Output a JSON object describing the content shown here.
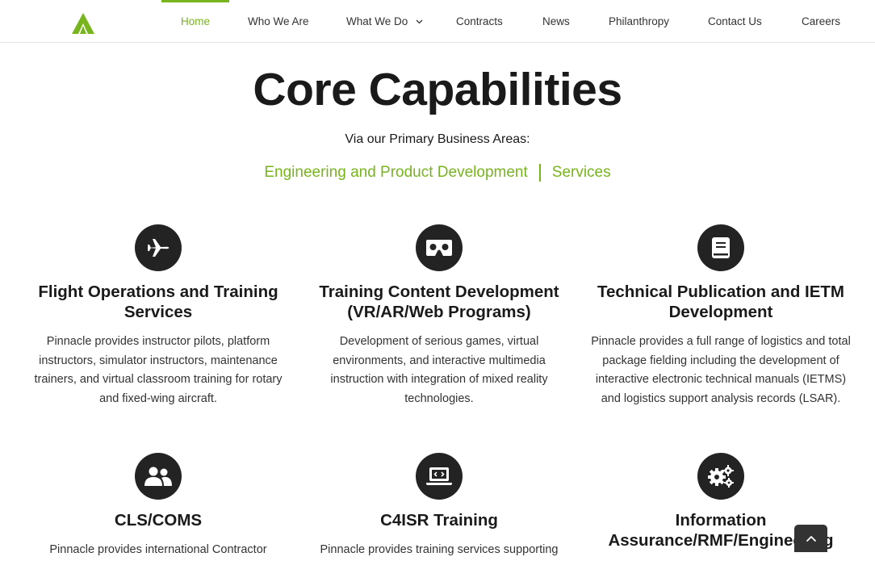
{
  "nav": {
    "logo_icon": "pinnacle-logo-triangle",
    "items": [
      {
        "label": "Home",
        "active": true
      },
      {
        "label": "Who We Are"
      },
      {
        "label": "What We Do"
      },
      {
        "label": "Contracts"
      },
      {
        "label": "News"
      },
      {
        "label": "Philanthropy"
      },
      {
        "label": "Contact Us"
      },
      {
        "label": "Careers"
      }
    ]
  },
  "hero": {
    "title": "Core Capabilities",
    "subtitle": "Via our Primary Business Areas:",
    "area_1": "Engineering and Product Development",
    "area_2": "Services"
  },
  "cards": [
    {
      "icon": "airplane-icon",
      "title": "Flight Operations and Training Services",
      "text": "Pinnacle provides instructor pilots, platform instructors, simulator instructors, maintenance trainers, and virtual classroom training for rotary and fixed-wing aircraft."
    },
    {
      "icon": "vr-headset-icon",
      "title": "Training Content Development (VR/AR/Web Programs)",
      "text": "Development of serious games, virtual environments, and interactive multimedia instruction with integration of mixed reality technologies."
    },
    {
      "icon": "book-icon",
      "title": "Technical Publication and IETM Development",
      "text": "Pinnacle provides a full range of logistics and total package fielding including the development of interactive electronic technical manuals (IETMS) and logistics support analysis records (LSAR)."
    },
    {
      "icon": "users-icon",
      "title": "CLS/COMS",
      "text": "Pinnacle provides international Contractor"
    },
    {
      "icon": "laptop-code-icon",
      "title": "C4ISR Training",
      "text": "Pinnacle provides training services supporting"
    },
    {
      "icon": "gears-icon",
      "title": "Information Assurance/RMF/Engineering",
      "text": ""
    }
  ],
  "colors": {
    "accent": "#78b41e",
    "icon_bg": "#232323",
    "text": "#333333"
  }
}
